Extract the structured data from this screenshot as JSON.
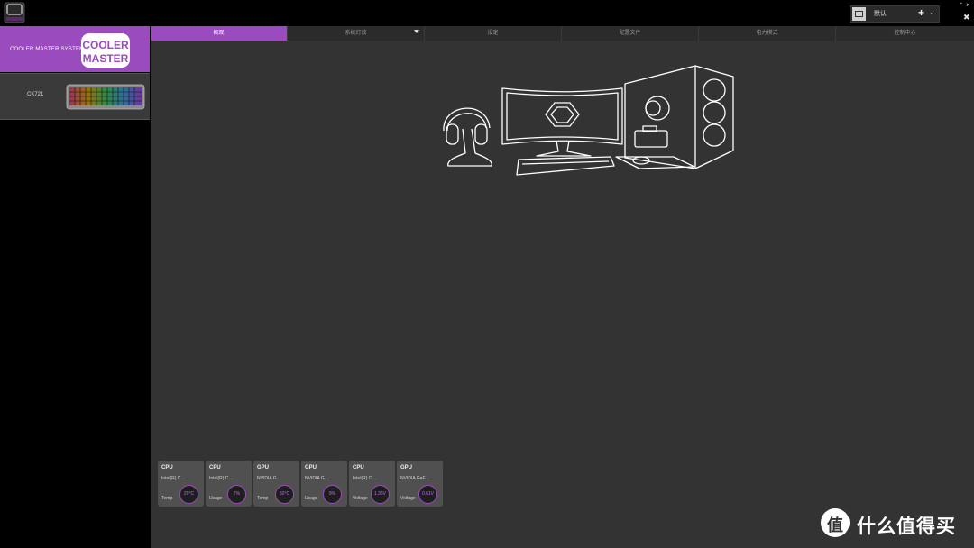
{
  "topbar": {
    "app_logo_icon": "cooler-master-app-icon",
    "profile": {
      "name": "默认",
      "add_label": "+",
      "dropdown_icon": "chevron-down-icon"
    },
    "window_controls": {
      "minimize": "-",
      "close": "×",
      "pin": "✖"
    }
  },
  "sidebar": {
    "devices": [
      {
        "name": "COOLER MASTER SYSTEM",
        "selected": true
      },
      {
        "name": "CK721",
        "selected": false
      }
    ],
    "brand_logo": {
      "line1": "COOLER",
      "line2": "MASTER"
    }
  },
  "tabs": [
    {
      "label": "概观",
      "active": true
    },
    {
      "label": "系统灯效",
      "active": false,
      "has_dropdown": true
    },
    {
      "label": "设定",
      "active": false
    },
    {
      "label": "配置文件",
      "active": false
    },
    {
      "label": "电力模式",
      "active": false
    },
    {
      "label": "控制中心",
      "active": false
    }
  ],
  "widgets": [
    {
      "type": "CPU",
      "model": "Intel(R) C....",
      "metric": "Temp",
      "value": "29°C"
    },
    {
      "type": "CPU",
      "model": "Intel(R) C....",
      "metric": "Usage",
      "value": "7%"
    },
    {
      "type": "GPU",
      "model": "NVIDIA G....",
      "metric": "Temp",
      "value": "50°C"
    },
    {
      "type": "GPU",
      "model": "NVIDIA G....",
      "metric": "Usage",
      "value": "9%"
    },
    {
      "type": "CPU",
      "model": "Intel(R) C....",
      "metric": "Voltage",
      "value": "1.36V"
    },
    {
      "type": "GPU",
      "model": "NVIDIA GeF....",
      "metric": "Voltage",
      "value": "0.61V"
    }
  ],
  "watermark": {
    "text": "什么值得买"
  },
  "colors": {
    "accent": "#9a4bbd",
    "background": "#333333",
    "sidebar": "#000000",
    "value_text": "#c070e8"
  }
}
